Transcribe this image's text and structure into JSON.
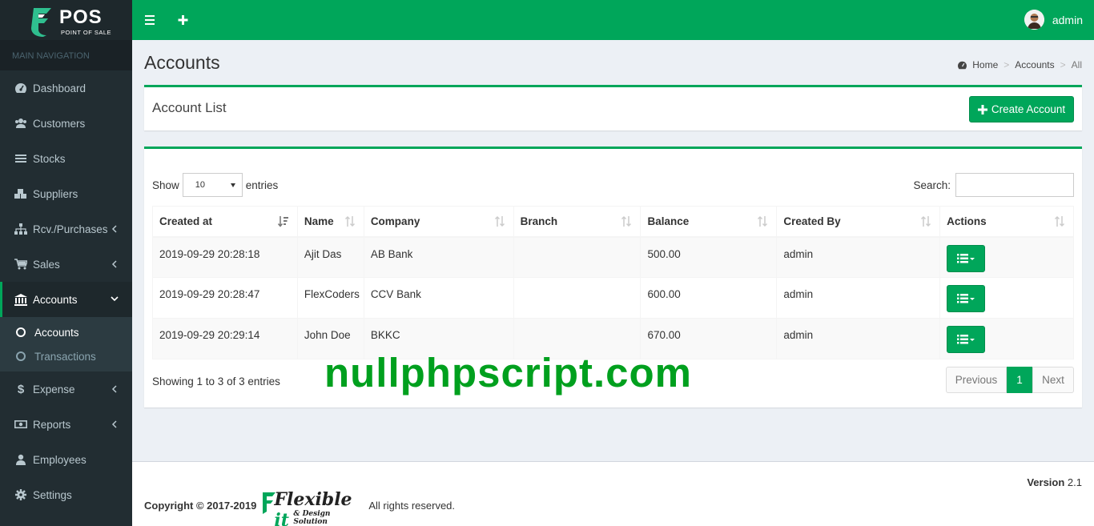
{
  "brand": {
    "name": "POS",
    "tagline": "POINT OF SALE"
  },
  "sidebar": {
    "header": "MAIN NAVIGATION",
    "items": [
      {
        "label": "Dashboard",
        "icon": "dashboard-icon"
      },
      {
        "label": "Customers",
        "icon": "users-icon"
      },
      {
        "label": "Stocks",
        "icon": "bars-icon"
      },
      {
        "label": "Suppliers",
        "icon": "cubes-icon"
      },
      {
        "label": "Rcv./Purchases",
        "icon": "sitemap-icon"
      },
      {
        "label": "Sales",
        "icon": "cart-icon"
      },
      {
        "label": "Accounts",
        "icon": "bank-icon"
      },
      {
        "label": "Expense",
        "icon": "dollar-icon"
      },
      {
        "label": "Reports",
        "icon": "money-icon"
      },
      {
        "label": "Employees",
        "icon": "user-icon"
      },
      {
        "label": "Settings",
        "icon": "gear-icon"
      }
    ],
    "submenu": [
      {
        "label": "Accounts"
      },
      {
        "label": "Transactions"
      }
    ]
  },
  "topbar": {
    "user": "admin"
  },
  "page": {
    "title": "Accounts",
    "breadcrumb": [
      "Home",
      "Accounts",
      "All"
    ]
  },
  "list_box": {
    "title": "Account List",
    "create_label": "Create Account"
  },
  "table_controls": {
    "show": "Show",
    "page_size": "10",
    "entries": "entries",
    "search_label": "Search:"
  },
  "table": {
    "columns": [
      "Created at",
      "Name",
      "Company",
      "Branch",
      "Balance",
      "Created By",
      "Actions"
    ],
    "rows": [
      {
        "created_at": "2019-09-29 20:28:18",
        "name": "Ajit Das",
        "company": "AB Bank",
        "branch": "",
        "balance": "500.00",
        "created_by": "admin"
      },
      {
        "created_at": "2019-09-29 20:28:47",
        "name": "FlexCoders",
        "company": "CCV Bank",
        "branch": "",
        "balance": "600.00",
        "created_by": "admin"
      },
      {
        "created_at": "2019-09-29 20:29:14",
        "name": "John Doe",
        "company": "BKKC",
        "branch": "",
        "balance": "670.00",
        "created_by": "admin"
      }
    ]
  },
  "table_info": "Showing 1 to 3 of 3 entries",
  "pagination": {
    "previous": "Previous",
    "current": "1",
    "next": "Next"
  },
  "watermark": "nullphpscript.com",
  "footer": {
    "copyright": "Copyright © 2017-2019",
    "logo_text_main": "Flexible",
    "logo_text_it": "it",
    "logo_text_sub": "& Design Solution",
    "rights": "All rights reserved.",
    "version_label": "Version",
    "version": "2.1"
  },
  "colors": {
    "accent": "#00a65a",
    "sidebar": "#222d32",
    "content_bg": "#ecf0f5",
    "watermark": "#00a01e"
  }
}
